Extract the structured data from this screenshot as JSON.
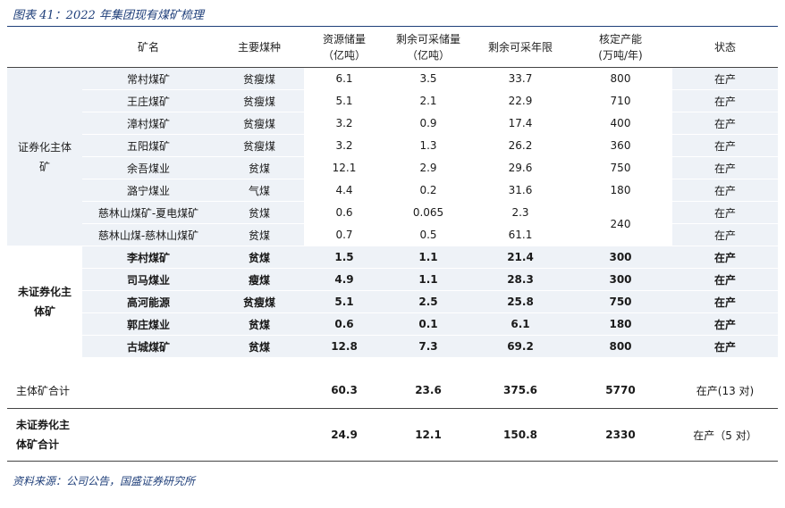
{
  "title": "图表 41：2022 年集团现有煤矿梳理",
  "source": "资料来源：公司公告，国盛证券研究所",
  "headers": {
    "mine": "矿名",
    "coal_type": "主要煤种",
    "reserve_l1": "资源储量",
    "reserve_l2": "（亿吨）",
    "remaining_l1": "剩余可采储量",
    "remaining_l2": "（亿吨）",
    "years": "剩余可采年限",
    "capacity_l1": "核定产能",
    "capacity_l2": "(万吨/年)",
    "status": "状态"
  },
  "group1_label": "证券化主体矿",
  "group2_label": "未证券化主体矿",
  "group1": [
    {
      "mine": "常村煤矿",
      "type": "贫瘦煤",
      "reserve": "6.1",
      "remaining": "3.5",
      "years": "33.7",
      "capacity": "800",
      "status": "在产"
    },
    {
      "mine": "王庄煤矿",
      "type": "贫瘦煤",
      "reserve": "5.1",
      "remaining": "2.1",
      "years": "22.9",
      "capacity": "710",
      "status": "在产"
    },
    {
      "mine": "漳村煤矿",
      "type": "贫瘦煤",
      "reserve": "3.2",
      "remaining": "0.9",
      "years": "17.4",
      "capacity": "400",
      "status": "在产"
    },
    {
      "mine": "五阳煤矿",
      "type": "贫瘦煤",
      "reserve": "3.2",
      "remaining": "1.3",
      "years": "26.2",
      "capacity": "360",
      "status": "在产"
    },
    {
      "mine": "余吾煤业",
      "type": "贫煤",
      "reserve": "12.1",
      "remaining": "2.9",
      "years": "29.6",
      "capacity": "750",
      "status": "在产"
    },
    {
      "mine": "潞宁煤业",
      "type": "气煤",
      "reserve": "4.4",
      "remaining": "0.2",
      "years": "31.6",
      "capacity": "180",
      "status": "在产"
    },
    {
      "mine": "慈林山煤矿-夏电煤矿",
      "type": "贫煤",
      "reserve": "0.6",
      "remaining": "0.065",
      "years": "2.3",
      "capacity": "240",
      "status": "在产"
    },
    {
      "mine": "慈林山煤-慈林山煤矿",
      "type": "贫煤",
      "reserve": "0.7",
      "remaining": "0.5",
      "years": "61.1",
      "capacity": "",
      "status": "在产"
    }
  ],
  "group2": [
    {
      "mine": "李村煤矿",
      "type": "贫煤",
      "reserve": "1.5",
      "remaining": "1.1",
      "years": "21.4",
      "capacity": "300",
      "status": "在产"
    },
    {
      "mine": "司马煤业",
      "type": "瘦煤",
      "reserve": "4.9",
      "remaining": "1.1",
      "years": "28.3",
      "capacity": "300",
      "status": "在产"
    },
    {
      "mine": "高河能源",
      "type": "贫瘦煤",
      "reserve": "5.1",
      "remaining": "2.5",
      "years": "25.8",
      "capacity": "750",
      "status": "在产"
    },
    {
      "mine": "郭庄煤业",
      "type": "贫煤",
      "reserve": "0.6",
      "remaining": "0.1",
      "years": "6.1",
      "capacity": "180",
      "status": "在产"
    },
    {
      "mine": "古城煤矿",
      "type": "贫煤",
      "reserve": "12.8",
      "remaining": "7.3",
      "years": "69.2",
      "capacity": "800",
      "status": "在产"
    }
  ],
  "total1": {
    "label": "主体矿合计",
    "reserve": "60.3",
    "remaining": "23.6",
    "years": "375.6",
    "capacity": "5770",
    "status": "在产(13 对)"
  },
  "total2": {
    "label_l1": "未证券化主",
    "label_l2": "体矿合计",
    "reserve": "24.9",
    "remaining": "12.1",
    "years": "150.8",
    "capacity": "2330",
    "status": "在产（5 对）"
  }
}
